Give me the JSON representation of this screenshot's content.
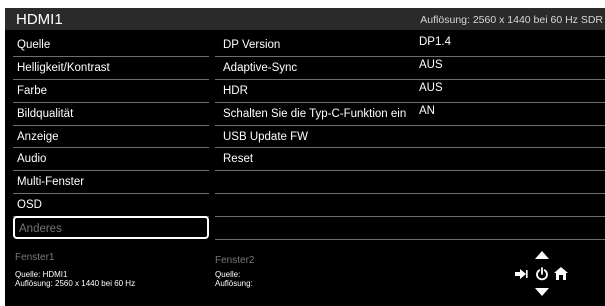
{
  "header": {
    "title": "HDMI1",
    "resolution": "Auflösung: 2560 x 1440 bei 60 Hz SDR"
  },
  "menu": {
    "items": [
      {
        "label": "Quelle"
      },
      {
        "label": "Helligkeit/Kontrast"
      },
      {
        "label": "Farbe"
      },
      {
        "label": "Bildqualität"
      },
      {
        "label": "Anzeige"
      },
      {
        "label": "Audio"
      },
      {
        "label": "Multi-Fenster"
      },
      {
        "label": "OSD"
      },
      {
        "label": "Anderes"
      }
    ],
    "selected": "Anderes"
  },
  "submenu": {
    "items": [
      {
        "label": "DP Version"
      },
      {
        "label": "Adaptive-Sync"
      },
      {
        "label": "HDR"
      },
      {
        "label": "Schalten Sie die Typ-C-Funktion ein"
      },
      {
        "label": "USB Update FW"
      },
      {
        "label": "Reset"
      }
    ]
  },
  "values": {
    "items": [
      {
        "label": "DP1.4"
      },
      {
        "label": "AUS"
      },
      {
        "label": "AUS"
      },
      {
        "label": "AN"
      }
    ]
  },
  "footer": {
    "fenster1": {
      "title": "Fenster1",
      "source": "Quelle: HDMI1",
      "resolution": "Auflösung: 2560 x 1440 bei 60 Hz"
    },
    "fenster2": {
      "title": "Fenster2",
      "source": "Quelle:",
      "resolution": "Auflösung:"
    }
  },
  "nav_icons": [
    "up-arrow-icon",
    "input-icon",
    "power-icon",
    "home-icon",
    "down-arrow-icon"
  ],
  "colors": {
    "background": "#000000",
    "titlebar": "#2a2a2a",
    "divider": "#6e6e6e",
    "disabled_text": "#777777"
  }
}
